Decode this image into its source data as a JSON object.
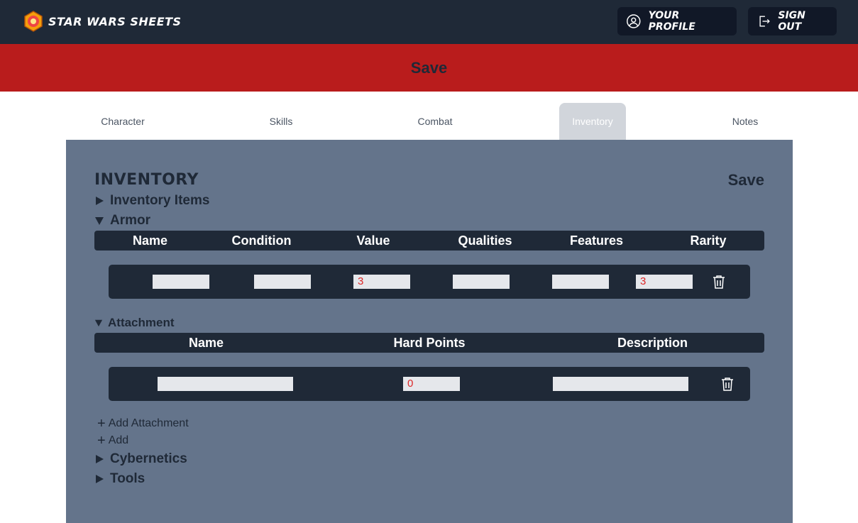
{
  "navbar": {
    "brand": "Star Wars Sheets",
    "profile_label": "Your Profile",
    "signout_label": "Sign Out"
  },
  "save_banner": {
    "label": "Save"
  },
  "tabs": [
    {
      "label": "Character"
    },
    {
      "label": "Skills"
    },
    {
      "label": "Combat"
    },
    {
      "label": "Inventory",
      "active": true
    },
    {
      "label": "Notes"
    }
  ],
  "inventory": {
    "title": "Inventory",
    "save_label": "Save",
    "sections": {
      "items": "Inventory Items",
      "armor": "Armor",
      "attachment": "Attachment",
      "cybernetics": "Cybernetics",
      "tools": "Tools"
    },
    "armor": {
      "columns": [
        "Name",
        "Condition",
        "Value",
        "Qualities",
        "Features",
        "Rarity"
      ],
      "rows": [
        {
          "name": "",
          "condition": "",
          "value": "3",
          "qualities": "",
          "features": "",
          "rarity": "3"
        }
      ]
    },
    "attachment": {
      "columns": [
        "Name",
        "Hard Points",
        "Description"
      ],
      "rows": [
        {
          "name": "",
          "hard_points": "0",
          "description": ""
        }
      ],
      "add_attachment_label": "Add Attachment"
    },
    "add_label": "Add"
  },
  "colors": {
    "navbar": "#1f2937",
    "banner": "#b91c1c",
    "panel": "#64748b",
    "value_text": "#dc2626"
  }
}
